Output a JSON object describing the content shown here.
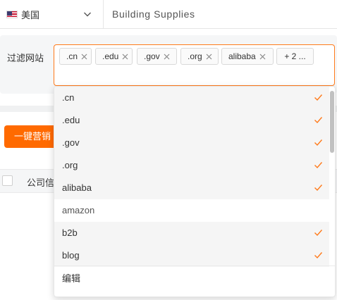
{
  "header": {
    "country": {
      "label": "美国",
      "flag_icon": "us-flag-icon"
    },
    "keyword": "Building Supplies"
  },
  "filter": {
    "label": "过滤网站",
    "selected_tags": [
      ".cn",
      ".edu",
      ".gov",
      ".org",
      "alibaba"
    ],
    "more_tag": "+ 2 ..."
  },
  "actions": {
    "one_click_label": "一键营销"
  },
  "table": {
    "columns": [
      "公司信息"
    ]
  },
  "dropdown": {
    "options": [
      {
        "label": ".cn",
        "selected": true
      },
      {
        "label": ".edu",
        "selected": true
      },
      {
        "label": ".gov",
        "selected": true
      },
      {
        "label": ".org",
        "selected": true
      },
      {
        "label": "alibaba",
        "selected": true
      },
      {
        "label": "amazon",
        "selected": false
      },
      {
        "label": "b2b",
        "selected": true
      },
      {
        "label": "blog",
        "selected": true
      }
    ],
    "footer_label": "编辑"
  },
  "colors": {
    "accent": "#ff6a00",
    "check": "#ff7a1a",
    "border_focus": "#ff7a1a"
  }
}
